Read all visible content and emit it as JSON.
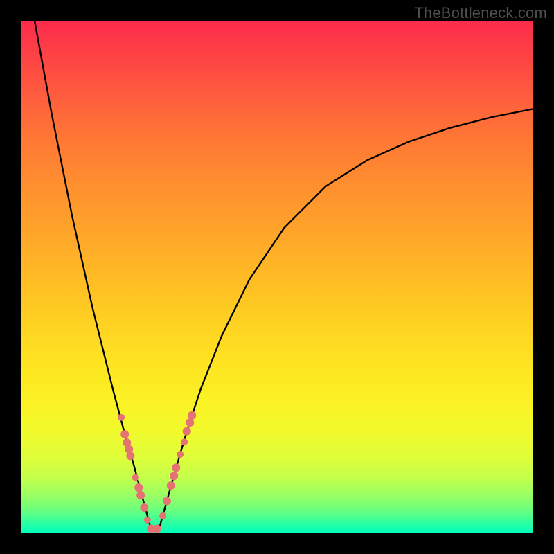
{
  "watermark": "TheBottleneck.com",
  "colors": {
    "frame": "#000000",
    "curve": "#000000",
    "marker": "#e57373",
    "gradient_top": "#fc2b4d",
    "gradient_bottom": "#00ffba"
  },
  "chart_data": {
    "type": "line",
    "title": "",
    "xlabel": "",
    "ylabel": "",
    "xlim": [
      0,
      100
    ],
    "ylim": [
      0,
      100
    ],
    "notes": "No numeric axis ticks are rendered; x and y are normalized 0–100 inferred from plot extents. Curve is a V-shaped bottleneck curve with minimum near x≈25.",
    "series": [
      {
        "name": "bottleneck-curve",
        "x": [
          2.7,
          6,
          10,
          14,
          18,
          20,
          22,
          24,
          25.4,
          27,
          28.5,
          30.2,
          32.4,
          35.1,
          39.2,
          44.6,
          51.4,
          59.5,
          67.6,
          75.7,
          83.8,
          91.9,
          100
        ],
        "y": [
          100,
          82,
          62,
          44,
          28,
          20.5,
          13.5,
          6,
          0.9,
          0.9,
          6.3,
          12.4,
          19.9,
          28.1,
          38.5,
          49.5,
          59.6,
          67.7,
          72.8,
          76.4,
          79.1,
          81.2,
          82.8
        ]
      }
    ],
    "markers": {
      "name": "highlighted-points",
      "points": [
        {
          "x": 19.6,
          "y": 22.6,
          "r": 5
        },
        {
          "x": 20.3,
          "y": 19.3,
          "r": 6
        },
        {
          "x": 20.7,
          "y": 17.7,
          "r": 6
        },
        {
          "x": 21.1,
          "y": 16.4,
          "r": 6
        },
        {
          "x": 21.4,
          "y": 15.1,
          "r": 6
        },
        {
          "x": 22.4,
          "y": 10.9,
          "r": 5
        },
        {
          "x": 23.0,
          "y": 8.9,
          "r": 6
        },
        {
          "x": 23.4,
          "y": 7.4,
          "r": 6
        },
        {
          "x": 24.1,
          "y": 5.0,
          "r": 6
        },
        {
          "x": 24.7,
          "y": 2.6,
          "r": 5
        },
        {
          "x": 25.4,
          "y": 0.9,
          "r": 6
        },
        {
          "x": 26.6,
          "y": 0.9,
          "r": 6
        },
        {
          "x": 27.7,
          "y": 3.4,
          "r": 5
        },
        {
          "x": 28.5,
          "y": 6.3,
          "r": 6
        },
        {
          "x": 29.3,
          "y": 9.3,
          "r": 6
        },
        {
          "x": 29.9,
          "y": 11.2,
          "r": 6
        },
        {
          "x": 30.3,
          "y": 12.8,
          "r": 6
        },
        {
          "x": 31.1,
          "y": 15.4,
          "r": 5
        },
        {
          "x": 31.9,
          "y": 17.8,
          "r": 5
        },
        {
          "x": 32.4,
          "y": 19.9,
          "r": 6
        },
        {
          "x": 33.0,
          "y": 21.6,
          "r": 6
        },
        {
          "x": 33.4,
          "y": 23.0,
          "r": 6
        }
      ]
    }
  }
}
